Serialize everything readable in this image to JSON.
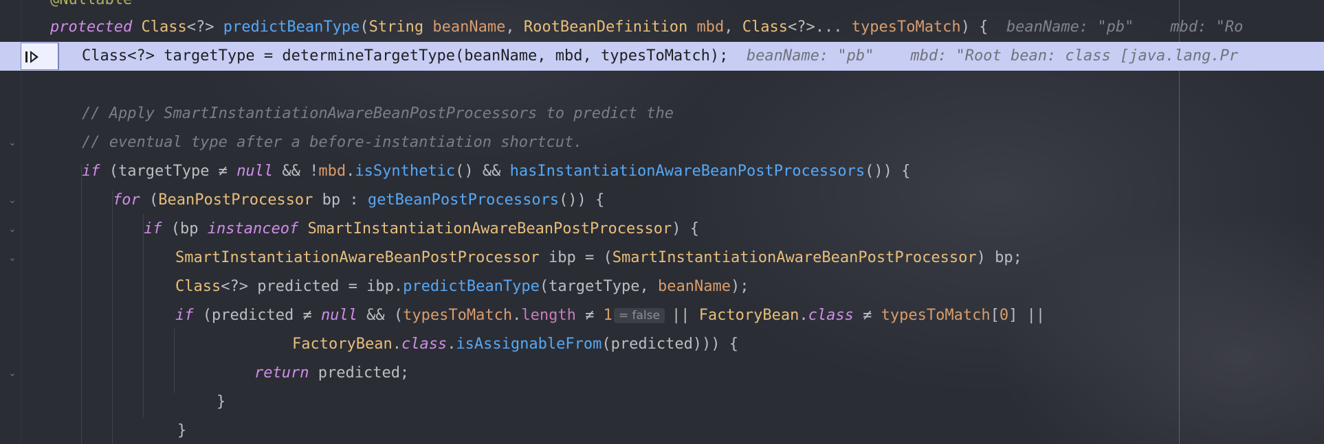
{
  "editor": {
    "annotation": "@Nullable",
    "gutter_icons": [
      "chevron-down-icon",
      "chevron-down-icon",
      "chevron-down-icon",
      "chevron-down-icon",
      "chevron-down-icon",
      "chevron-down-icon"
    ],
    "signature": {
      "modifier": "protected",
      "ret_type": "Class",
      "generic": "<?>",
      "method": "predictBeanType",
      "open_paren": "(",
      "p1_type": "String",
      "p1_name": "beanName",
      "comma1": ",",
      "p2_type": "RootBeanDefinition",
      "p2_name": "mbd",
      "comma2": ",",
      "p3_type": "Class",
      "p3_generic": "<?>...",
      "p3_name": "typesToMatch",
      "close": ") {",
      "inlay_beanName": "beanName: \"pb\"",
      "inlay_mbd": "mbd: \"Ro"
    },
    "exec_line": {
      "code": "Class<?> targetType = determineTargetType(beanName, mbd, typesToMatch);",
      "inlay_beanName": "beanName: \"pb\"",
      "inlay_mbd": "mbd: \"Root bean: class [java.lang.Pr"
    },
    "comment1": "// Apply SmartInstantiationAwareBeanPostProcessors to predict the",
    "comment2": "// eventual type after a before-instantiation shortcut.",
    "if1": {
      "kw": "if",
      "a": " (targetType ≠ ",
      "null": "null",
      "b": " && !",
      "mbd": "mbd",
      "dot": ".",
      "isSynthetic": "isSynthetic",
      "c": "() && ",
      "has": "hasInstantiationAwareBeanPostProcessors",
      "d": "()) {"
    },
    "for1": {
      "kw": "for",
      "a": " (",
      "type": "BeanPostProcessor",
      "b": " bp : ",
      "fn": "getBeanPostProcessors",
      "c": "()) {"
    },
    "if2": {
      "kw": "if",
      "a": " (bp ",
      "instanceof": "instanceof",
      "sp": " ",
      "type": "SmartInstantiationAwareBeanPostProcessor",
      "b": ") {"
    },
    "decl_ibp": {
      "type": "SmartInstantiationAwareBeanPostProcessor",
      "a": " ibp = (",
      "type2": "SmartInstantiationAwareBeanPostProcessor",
      "b": ") bp;"
    },
    "decl_pred": {
      "type": "Class",
      "a": "<?> predicted = ibp.",
      "fn": "predictBeanType",
      "b": "(targetType, ",
      "param": "beanName",
      "c": ");"
    },
    "if3": {
      "kw": "if",
      "a": " (predicted ≠ ",
      "null": "null",
      "b": " && (",
      "param": "typesToMatch",
      "dot": ".",
      "field": "length",
      "c": " ≠ ",
      "num": "1",
      "hint": "= false",
      "d": "|| ",
      "type": "FactoryBean",
      "dot2": ".",
      "cls": "class",
      "e": " ≠ ",
      "param2": "typesToMatch",
      "f": "[",
      "num2": "0",
      "g": "] ||"
    },
    "cont": {
      "type": "FactoryBean",
      "dot": ".",
      "cls": "class",
      "dot2": ".",
      "fn": "isAssignableFrom",
      "a": "(predicted))) {"
    },
    "ret": {
      "kw": "return",
      "a": " predicted;"
    },
    "close1": "}",
    "close2": "}"
  }
}
